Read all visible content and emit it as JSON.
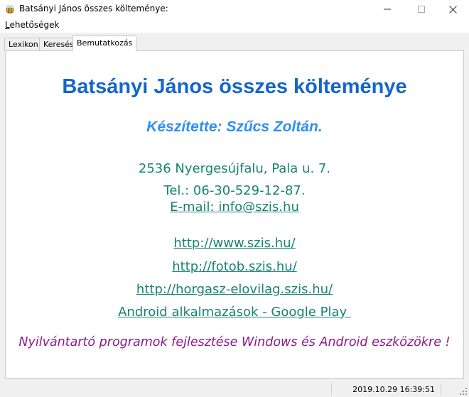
{
  "window": {
    "title": "Batsányi János összes költeménye:",
    "icon": "bee-app-icon",
    "controls": [
      "minimize-icon",
      "maximize-icon",
      "close-icon"
    ]
  },
  "menu": {
    "items": [
      {
        "accel": "L",
        "rest": "ehetőségek"
      }
    ]
  },
  "tabs": [
    {
      "label": "Lexikon",
      "active": false
    },
    {
      "label": "Keresés",
      "active": false
    },
    {
      "label": "Bemutatkozás",
      "active": true
    }
  ],
  "about": {
    "heading": "Batsányi János összes költeménye",
    "author": "Készítette: Szűcs Zoltán.",
    "address": "2536 Nyergesújfalu, Pala u. 7.",
    "phone": "Tel.: 06-30-529-12-87.",
    "email": "E-mail: info@szis.hu",
    "links": [
      "http://www.szis.hu/",
      "http://fotob.szis.hu/",
      "http://horgasz-elovilag.szis.hu/",
      "Android alkalmazások - Google Play "
    ],
    "tagline": "Nyilvántartó programok fejlesztése Windows és Android eszközökre !"
  },
  "colors": {
    "heading": "#1466c8",
    "author": "#2f8ff0",
    "info": "#16836f",
    "tagline": "#8b1a8b"
  },
  "status": {
    "datetime": "2019.10.29 16:39:51"
  }
}
